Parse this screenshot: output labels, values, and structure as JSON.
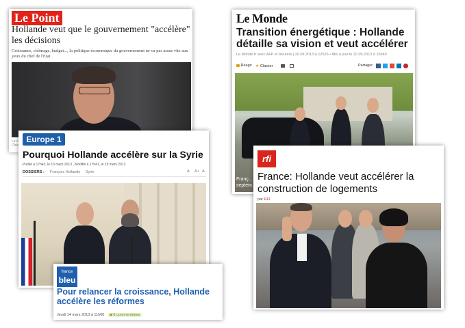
{
  "lepoint": {
    "logo": "Le Point",
    "title": "Hollande veut que le gouvernement \"accélère\" les décisions",
    "summary": "Croissance, chômage, budget..., la politique économique du gouvernement ne va pas assez vite aux yeux du chef de l'Etat.",
    "caption": "Le ch... Chin..."
  },
  "lemonde": {
    "logo": "Le Monde",
    "title": "Transition énergétique : Hollande détaille sa vision et veut accélérer",
    "byline": "Le Monde.fr avec AFP et Reuters | 20.09.2013 à 12h26 • Mis à jour le 20.09.2013 à 15h40",
    "actions": [
      "Réagir",
      "Classer"
    ],
    "share_label": "Partager",
    "caption": "Franç... septem..."
  },
  "europe1": {
    "logo": "Europe 1",
    "title": "Pourquoi Hollande accélère sur la Syrie",
    "meta": "Publié à 17h43, le 15 mars 2013 , Modifié à 17h41, le 15 mars 2013",
    "dossiers_label": "DOSSIERS :",
    "dossiers": [
      "François Hollande",
      "Syrie"
    ],
    "font_controls": [
      "A",
      "A+",
      "A-"
    ]
  },
  "rfi": {
    "logo": "rfi",
    "title": "France: Hollande veut accélérer la construction de logements",
    "byline_prefix": "par",
    "byline_author": "RFI"
  },
  "francebleu": {
    "logo_top": "france",
    "logo_bottom": "bleu",
    "title": "Pour relancer la croissance, Hollande accélère les réformes",
    "date": "Jeudi 14 mars 2013 à 11h00",
    "comments": "6 commentaires"
  },
  "colors": {
    "lepoint_red": "#e2231a",
    "lemonde_title": "#1a1a1a",
    "europe1_blue": "#1d5fa8",
    "rfi_red": "#d9261c",
    "francebleu_blue": "#1f5fae"
  }
}
